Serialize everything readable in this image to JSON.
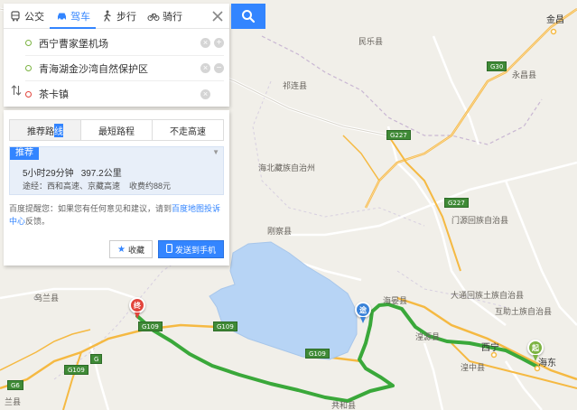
{
  "modes": [
    {
      "id": "bus",
      "label": "公交",
      "icon": "bus-icon"
    },
    {
      "id": "drive",
      "label": "驾车",
      "icon": "car-icon"
    },
    {
      "id": "walk",
      "label": "步行",
      "icon": "walk-icon"
    },
    {
      "id": "bike",
      "label": "骑行",
      "icon": "bike-icon"
    }
  ],
  "active_mode": "drive",
  "stops": {
    "start": "西宁曹家堡机场",
    "via": "青海湖金沙湾自然保护区",
    "end": "茶卡镇"
  },
  "route_tabs": {
    "recommended_prefix": "推荐路",
    "recommended_highlight": "线",
    "shortest": "最短路程",
    "no_highway": "不走高速"
  },
  "route_card": {
    "badge": "推荐",
    "duration": "5小时29分钟",
    "distance": "397.2公里",
    "via": "途经：西和高速、京藏高速",
    "toll": "收费约88元"
  },
  "notice": {
    "before": "百度提醒您：如果您有任何意见和建议，请到",
    "link": "百度地图投诉中心",
    "after": "反馈。"
  },
  "actions": {
    "favorite": "收藏",
    "send": "发送到手机"
  },
  "markers": {
    "start": "起",
    "via": "途",
    "end": "终"
  },
  "map_labels": {
    "jinchang": "金昌",
    "minle": "民乐县",
    "yongchang": "永昌县",
    "qilian": "祁连县",
    "haibei": "海北藏族自治州",
    "menyuan": "门源回族自治县",
    "gangcha": "刚察县",
    "haiyan": "海晏县",
    "datong": "大通回族土族自治县",
    "huzhu": "互助土族自治县",
    "xining": "西宁",
    "ledu": "海东",
    "huangzhong": "湟中县",
    "huangyuan": "湟源县",
    "gonghe": "共和县",
    "wulan": "乌兰县",
    "dulan": "兰县"
  },
  "roads": {
    "g30": "G30",
    "g227a": "G227",
    "g227b": "G227",
    "g109a": "G109",
    "g109b": "G109",
    "g109c": "G109",
    "g109d": "G109",
    "g6": "G6",
    "g": "G"
  },
  "colors": {
    "accent": "#3385ff",
    "route": "#3aa83a",
    "water": "#b7d4f5"
  }
}
